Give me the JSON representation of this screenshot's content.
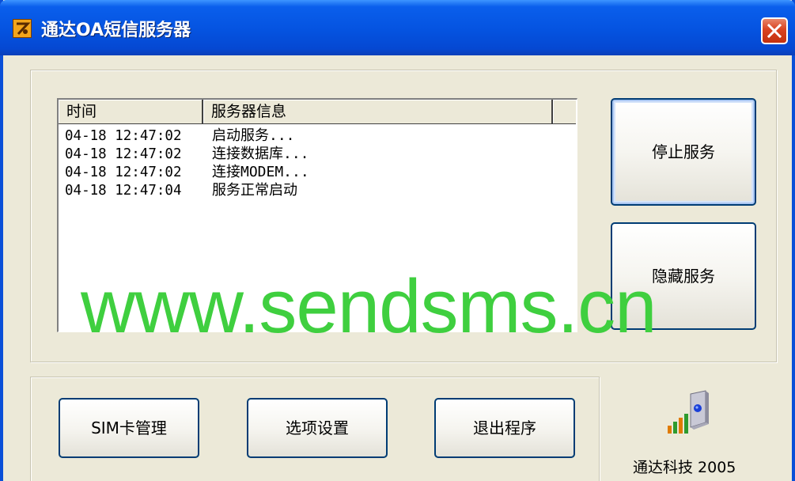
{
  "window": {
    "title": "通达OA短信服务器",
    "close_icon": "close-icon",
    "app_icon": "app-logo-icon"
  },
  "log": {
    "columns": [
      "时间",
      "服务器信息",
      ""
    ],
    "rows": [
      {
        "time": "04-18 12:47:02",
        "message": "启动服务..."
      },
      {
        "time": "04-18 12:47:02",
        "message": "连接数据库..."
      },
      {
        "time": "04-18 12:47:02",
        "message": "连接MODEM..."
      },
      {
        "time": "04-18 12:47:04",
        "message": "服务正常启动"
      }
    ]
  },
  "buttons": {
    "stop_service": "停止服务",
    "hide_service": "隐藏服务",
    "sim_manage": "SIM卡管理",
    "options": "选项设置",
    "exit": "退出程序"
  },
  "footer": {
    "company": "通达科技 2005",
    "logo_icon": "signal-phone-icon"
  },
  "watermark": "www.sendsms.cn",
  "colors": {
    "titlebar": "#0553e0",
    "window_bg": "#ece9d8",
    "close_button": "#d9421f",
    "watermark": "#3fcf3f",
    "button_border": "#003c74"
  }
}
